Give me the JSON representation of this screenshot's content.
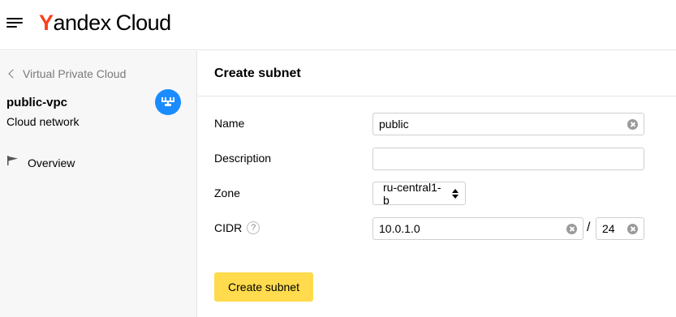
{
  "header": {
    "logo_y": "Y",
    "logo_rest": "andex",
    "logo_cloud": "Cloud",
    "menu_icon": "hamburger-menu-icon"
  },
  "sidebar": {
    "back_label": "Virtual Private Cloud",
    "network_name": "public-vpc",
    "network_type": "Cloud network",
    "network_icon": "vpc-network-icon",
    "nav": [
      {
        "label": "Overview",
        "icon": "flag-icon"
      }
    ]
  },
  "form": {
    "title": "Create subnet",
    "name": {
      "label": "Name",
      "value": "public"
    },
    "description": {
      "label": "Description",
      "value": ""
    },
    "zone": {
      "label": "Zone",
      "value": "ru-central1-b"
    },
    "cidr": {
      "label": "CIDR",
      "help": "?",
      "address": "10.0.1.0",
      "separator": "/",
      "prefix": "24"
    },
    "submit_label": "Create subnet"
  },
  "colors": {
    "brand_red": "#fc3f1d",
    "accent_blue": "#1a8cff",
    "primary_button": "#ffdb4d"
  }
}
